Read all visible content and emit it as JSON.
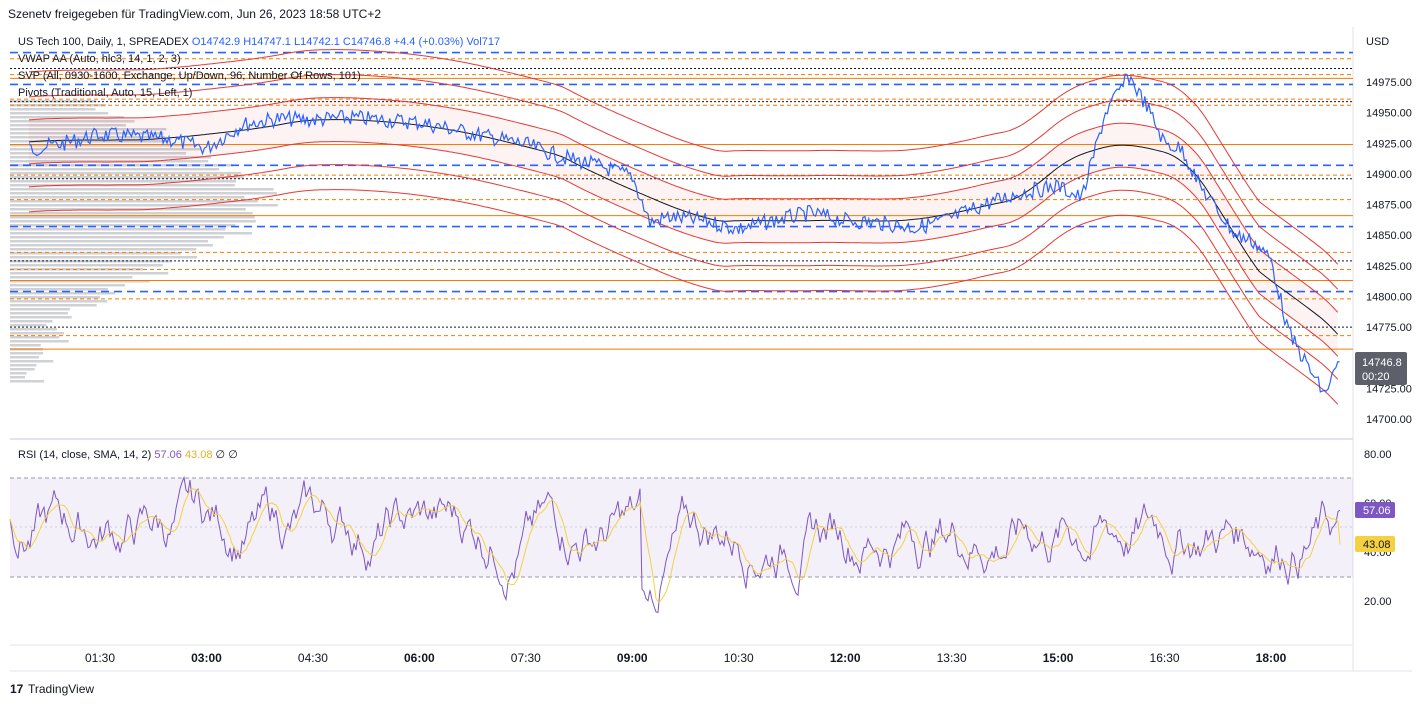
{
  "header": {
    "published_by": "Szenetv freigegeben für TradingView.com, Jun 26, 2023 18:58 UTC+2"
  },
  "legend": {
    "symbol": "US Tech 100, Daily, 1, SPREADEX",
    "ohlc": "O14742.9 H14747.1 L14742.1 C14746.8 +4.4 (+0.03%) Vol717",
    "vwap": "VWAP AA (Auto, hlc3, 14, 1, 2, 3)",
    "svp": "SVP (All, 0930-1600, Exchange, Up/Down, 96, Number Of Rows, 101)",
    "pivots": "Pivots (Traditional, Auto, 15, Left, 1)"
  },
  "rsi_legend": {
    "label": "RSI (14, close, SMA, 14, 2)",
    "rsi_value": "57.06",
    "sma_value": "43.08",
    "empty1": "∅",
    "empty2": "∅"
  },
  "currency": "USD",
  "last_price": {
    "value": "14746.8",
    "countdown": "00:20"
  },
  "rsi_badges": {
    "rsi": "57.06",
    "sma": "43.08"
  },
  "footer": {
    "brand": "TradingView"
  },
  "colors": {
    "price": "#2962ff",
    "vwap_band": "#e53935",
    "vwap_mid": "#131722",
    "rsi": "#7e57c2",
    "rsi_sma": "#f5d142",
    "pivot_blue": "#2962ff",
    "pivot_orange": "#f57c00",
    "volume": "#9598a1"
  },
  "chart_data": [
    {
      "type": "line",
      "title": "US Tech 100, Daily, 1, SPREADEX",
      "x_ticks": [
        "01:30",
        "03:00",
        "04:30",
        "06:00",
        "07:30",
        "09:00",
        "10:30",
        "12:00",
        "13:30",
        "15:00",
        "16:30",
        "18:00"
      ],
      "y_ticks": [
        14975,
        14950,
        14925,
        14900,
        14875,
        14850,
        14825,
        14800,
        14775,
        14725,
        14700
      ],
      "ylim": [
        14690,
        15010
      ],
      "series": [
        {
          "x": [
            "00:30",
            "01:00",
            "01:30",
            "02:00",
            "02:30",
            "03:00",
            "03:30",
            "04:00",
            "04:30",
            "05:00",
            "05:30",
            "06:00",
            "06:30",
            "07:00",
            "07:30",
            "08:00",
            "08:30",
            "09:00",
            "09:15",
            "09:30",
            "10:00",
            "10:30",
            "11:00",
            "11:30",
            "12:00",
            "12:30",
            "13:00",
            "13:30",
            "14:00",
            "14:30",
            "15:00",
            "15:20",
            "15:40",
            "16:00",
            "16:15",
            "16:30",
            "16:45",
            "17:00",
            "17:30",
            "17:45",
            "18:00",
            "18:15",
            "18:30",
            "18:45",
            "18:58"
          ],
          "values": [
            14920,
            14925,
            14932,
            14930,
            14928,
            14921,
            14940,
            14945,
            14944,
            14946,
            14944,
            14942,
            14936,
            14930,
            14924,
            14914,
            14907,
            14898,
            14860,
            14865,
            14862,
            14855,
            14862,
            14868,
            14862,
            14860,
            14856,
            14864,
            14876,
            14885,
            14890,
            14880,
            14950,
            14980,
            14955,
            14925,
            14920,
            14890,
            14850,
            14845,
            14830,
            14770,
            14745,
            14720,
            14746.8
          ]
        }
      ],
      "horizontal_levels": [
        14999,
        14994,
        14986,
        14981,
        14978,
        14973,
        14961,
        14959,
        14956,
        14924,
        14907,
        14899,
        14896,
        14879,
        14866,
        14857,
        14836,
        14829,
        14822,
        14813,
        14804,
        14798,
        14775,
        14768,
        14757
      ]
    },
    {
      "type": "line",
      "title": "RSI (14, close, SMA, 14, 2)",
      "y_ticks": [
        80,
        60,
        40,
        20
      ],
      "bands": [
        70,
        50,
        30
      ],
      "ylim": [
        10,
        85
      ],
      "series": [
        {
          "name": "RSI",
          "last": 57.06
        },
        {
          "name": "SMA",
          "last": 43.08
        }
      ]
    }
  ]
}
